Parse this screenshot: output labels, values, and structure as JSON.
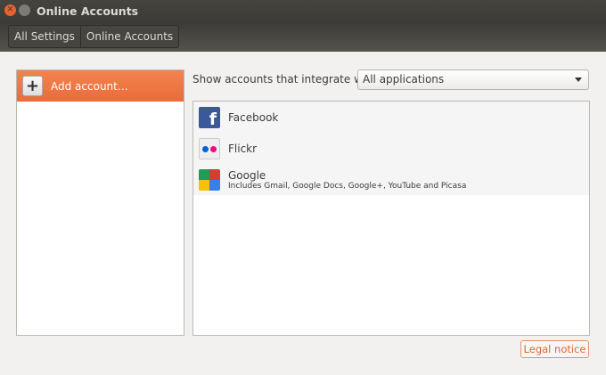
{
  "window": {
    "title": "Online Accounts"
  },
  "breadcrumbs": [
    "All Settings",
    "Online Accounts"
  ],
  "sidebar": {
    "add_account": "Add account…"
  },
  "filter": {
    "label": "Show accounts that integrate with:",
    "selected": "All applications"
  },
  "providers": [
    {
      "name": "Facebook",
      "icon": "facebook-icon"
    },
    {
      "name": "Flickr",
      "icon": "flickr-icon"
    },
    {
      "name": "Google",
      "icon": "google-icon",
      "description": "Includes Gmail, Google Docs, Google+, YouTube and Picasa"
    }
  ],
  "legal_notice": "Legal notice",
  "colors": {
    "accent": "#e86c38",
    "titlebar": "#3c3b37"
  }
}
